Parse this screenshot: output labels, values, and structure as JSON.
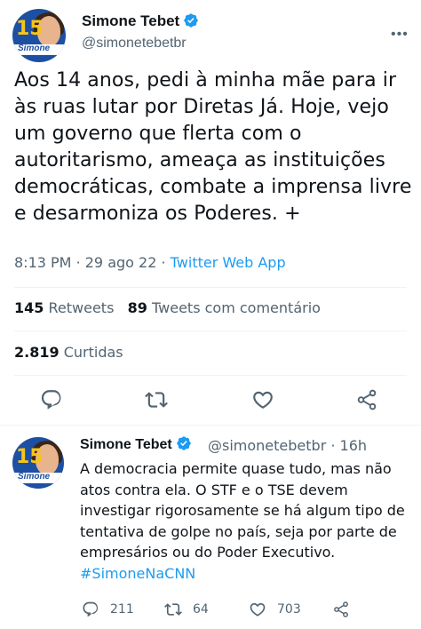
{
  "main_tweet": {
    "avatar": {
      "number": "15",
      "band_text": "Simone"
    },
    "author_name": "Simone Tebet",
    "handle": "@simonetebetbr",
    "text": "Aos 14 anos, pedi à minha mãe para ir às ruas lutar por Diretas Já. Hoje, vejo um governo que flerta com o autoritarismo, ameaça as instituições democráticas, combate a imprensa livre e desarmoniza os Poderes. +",
    "time": "8:13 PM",
    "date": "29 ago 22",
    "separator": "·",
    "source_app": "Twitter Web App",
    "retweets_count": "145",
    "retweets_label": "Retweets",
    "quote_count": "89",
    "quote_label": "Tweets com comentário",
    "likes_count": "2.819",
    "likes_label": "Curtidas"
  },
  "reply_tweet": {
    "avatar": {
      "number": "15",
      "band_text": "Simone"
    },
    "author_name": "Simone Tebet",
    "handle_time": "@simonetebetbr · 16h",
    "text": "A democracia permite quase tudo, mas não atos contra ela. O STF e o TSE devem investigar rigorosamente se há algum tipo de tentativa de golpe no país, seja por parte de empresários ou do Poder Executivo.",
    "hashtag": "#SimoneNaCNN",
    "reply_count": "211",
    "retweet_count": "64",
    "like_count": "703"
  },
  "colors": {
    "accent": "#1d9bf0",
    "secondary_text": "#536471",
    "divider": "#eff3f4"
  },
  "icons": [
    "verified-badge-icon",
    "more-icon",
    "reply-icon",
    "retweet-icon",
    "like-icon",
    "share-icon"
  ]
}
